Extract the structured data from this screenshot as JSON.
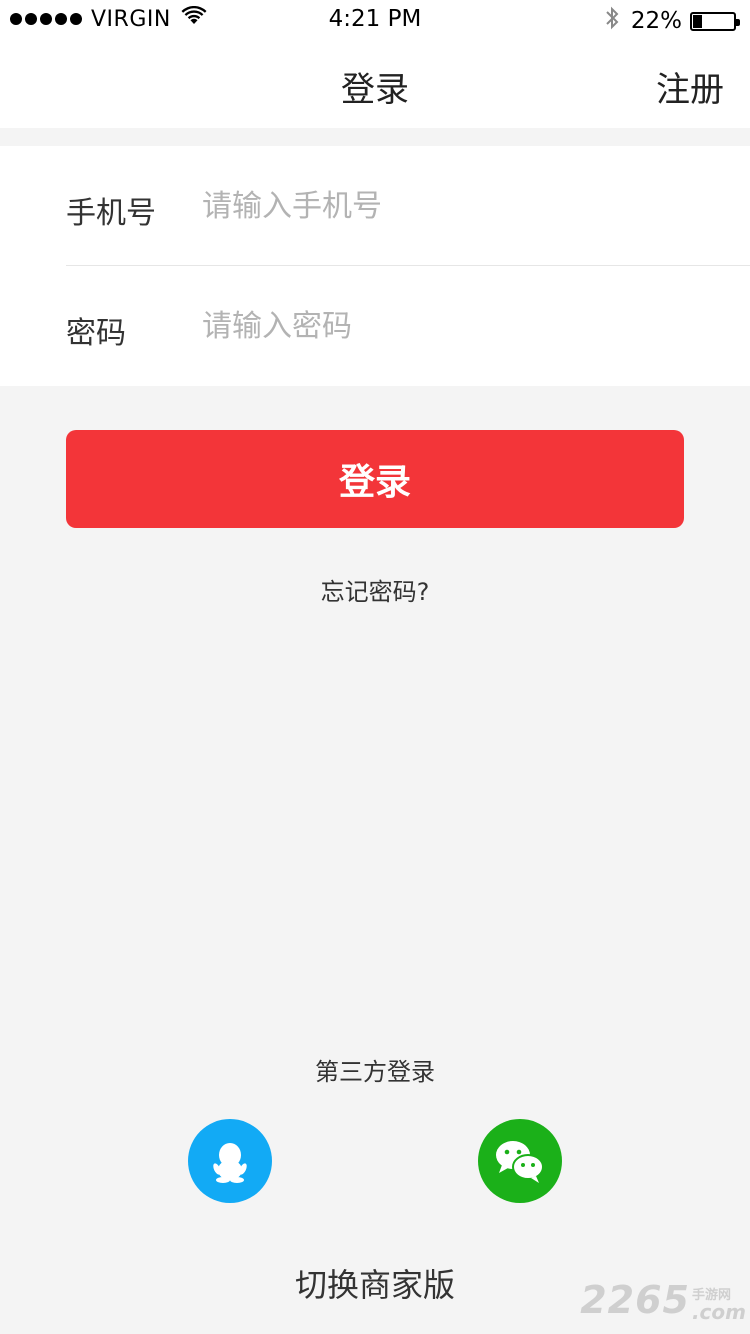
{
  "status_bar": {
    "carrier": "VIRGIN",
    "time": "4:21 PM",
    "battery": "22%",
    "battery_level": 0.22
  },
  "nav": {
    "title": "登录",
    "register": "注册"
  },
  "form": {
    "phone_label": "手机号",
    "phone_placeholder": "请输入手机号",
    "password_label": "密码",
    "password_placeholder": "请输入密码"
  },
  "actions": {
    "login": "登录",
    "forgot": "忘记密码?"
  },
  "third_party": {
    "title": "第三方登录",
    "providers": [
      {
        "icon": "qq-icon",
        "color": "#12aaf5"
      },
      {
        "icon": "wechat-icon",
        "color": "#1bb019"
      }
    ]
  },
  "switch": "切换商家版",
  "watermark": {
    "number": "2265",
    "cn": "手游网",
    "domain": ".com"
  },
  "colors": {
    "accent": "#f33539",
    "background": "#f4f4f4"
  }
}
